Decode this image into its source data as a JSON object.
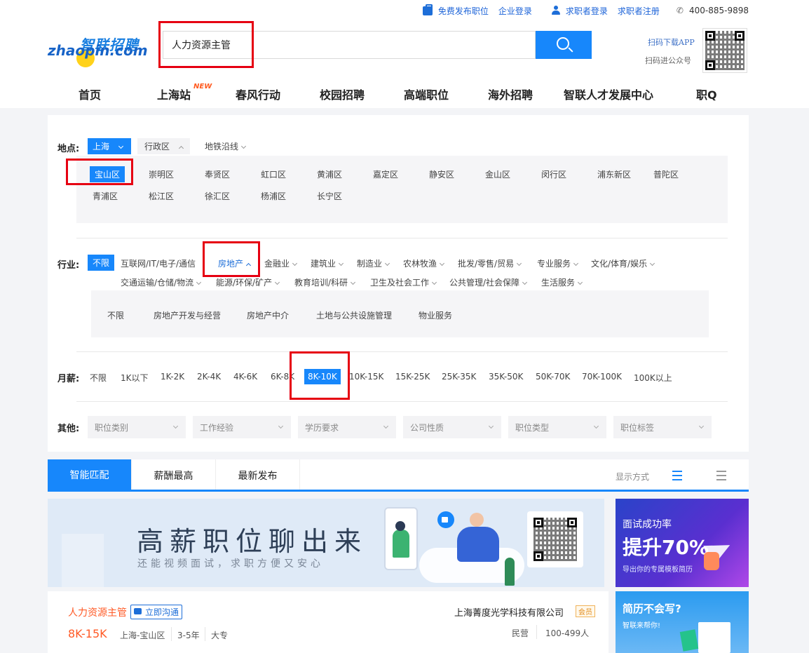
{
  "header": {
    "topbar": {
      "post_job": "免费发布职位",
      "company_login": "企业登录",
      "seeker_login": "求职者登录",
      "seeker_register": "求职者注册",
      "phone": "400-885-9898"
    },
    "logo": {
      "cn": "智联招聘",
      "en": "zhaopin.com"
    },
    "search": {
      "value": "人力资源主管",
      "placeholder": ""
    },
    "qr": {
      "app_text": "扫码下载APP",
      "official_text": "扫码进公众号"
    },
    "nav": [
      {
        "label": "首页"
      },
      {
        "label": "上海站",
        "badge": "NEW"
      },
      {
        "label": "春风行动"
      },
      {
        "label": "校园招聘"
      },
      {
        "label": "高端职位"
      },
      {
        "label": "海外招聘"
      },
      {
        "label": "智联人才发展中心"
      },
      {
        "label": "职Q"
      }
    ]
  },
  "filters": {
    "location": {
      "label": "地点:",
      "city": "上海",
      "district_dd": "行政区",
      "metro_dd": "地铁沿线",
      "districts_row1": [
        "宝山区",
        "崇明区",
        "奉贤区",
        "虹口区",
        "黄浦区",
        "嘉定区",
        "静安区",
        "金山区",
        "闵行区",
        "浦东新区",
        "普陀区"
      ],
      "districts_row2": [
        "青浦区",
        "松江区",
        "徐汇区",
        "杨浦区",
        "长宁区"
      ],
      "selected_district": "宝山区"
    },
    "industry": {
      "label": "行业:",
      "all": "不限",
      "row1": [
        "互联网/IT/电子/通信",
        "房地产",
        "金融业",
        "建筑业",
        "制造业",
        "农林牧渔",
        "批发/零售/贸易",
        "专业服务",
        "文化/体育/娱乐"
      ],
      "row2": [
        "交通运输/仓储/物流",
        "能源/环保/矿产",
        "教育培训/科研",
        "卫生及社会工作",
        "公共管理/社会保障",
        "生活服务"
      ],
      "selected": "房地产",
      "sub": [
        "不限",
        "房地产开发与经营",
        "房地产中介",
        "土地与公共设施管理",
        "物业服务"
      ]
    },
    "salary": {
      "label": "月薪:",
      "options": [
        "不限",
        "1K以下",
        "1K-2K",
        "2K-4K",
        "4K-6K",
        "6K-8K",
        "8K-10K",
        "10K-15K",
        "15K-25K",
        "25K-35K",
        "35K-50K",
        "50K-70K",
        "70K-100K",
        "100K以上"
      ],
      "selected": "8K-10K"
    },
    "other": {
      "label": "其他:",
      "dropdowns": [
        "职位类别",
        "工作经验",
        "学历要求",
        "公司性质",
        "职位类型",
        "职位标签"
      ]
    }
  },
  "tabs": {
    "items": [
      "智能匹配",
      "薪酬最高",
      "最新发布"
    ],
    "active": "智能匹配",
    "view_mode_label": "显示方式"
  },
  "banner": {
    "title": "高薪职位聊出来",
    "subtitle": "还能视频面试，求职方便又安心"
  },
  "ads": [
    {
      "line1": "面试成功率",
      "line2": "提升70%",
      "line3": "导出你的专属模板简历"
    },
    {
      "line1": "简历不会写?",
      "line2": "智联来帮你!"
    }
  ],
  "job": {
    "title": "人力资源主管",
    "chat_label": "立即沟通",
    "salary": "8K-15K",
    "location": "上海-宝山区",
    "experience": "3-5年",
    "education": "大专",
    "company": "上海菁度光学科技有限公司",
    "vip_badge": "会员",
    "company_type": "民营",
    "company_size": "100-499人"
  },
  "colors": {
    "brand_blue": "#1787fb",
    "highlight_red": "#e60012",
    "salary_orange": "#ff5a26"
  }
}
